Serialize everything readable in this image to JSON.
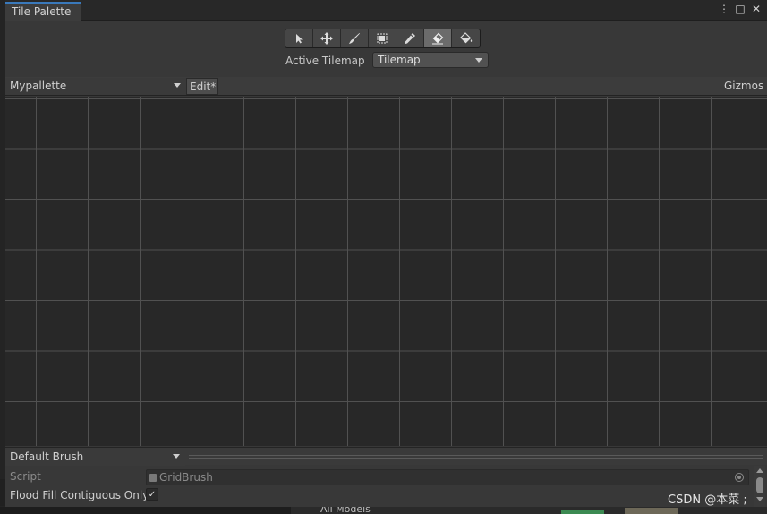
{
  "window": {
    "tab_title": "Tile Palette",
    "controls": {
      "menu_icon": "⋮",
      "maximize_icon": "□",
      "close_icon": "✕"
    }
  },
  "toolbar": {
    "tools": [
      {
        "name": "select",
        "glyph": "▶"
      },
      {
        "name": "move",
        "glyph": "✥"
      },
      {
        "name": "paint",
        "glyph": "✎"
      },
      {
        "name": "box-fill",
        "glyph": "▣"
      },
      {
        "name": "pick",
        "glyph": "✑"
      },
      {
        "name": "erase",
        "glyph": "◇",
        "active": true
      },
      {
        "name": "fill",
        "glyph": "◮"
      }
    ]
  },
  "active_tilemap": {
    "label": "Active Tilemap",
    "value": "Tilemap"
  },
  "palette_bar": {
    "palette": "Mypallette",
    "edit": "Edit*",
    "gizmos": "Gizmos"
  },
  "brush": {
    "selected": "Default Brush"
  },
  "inspector": {
    "script_label": "Script",
    "script_value": "GridBrush",
    "flood_label": "Flood Fill Contiguous Only",
    "flood_checked": true,
    "check_glyph": "✓"
  },
  "background": {
    "panel_text": "All Models"
  },
  "watermark": "CSDN @本菜 ;",
  "colors": {
    "accent": "#3a79bb",
    "grid_bg": "#282828",
    "grid_line": "#515151"
  }
}
